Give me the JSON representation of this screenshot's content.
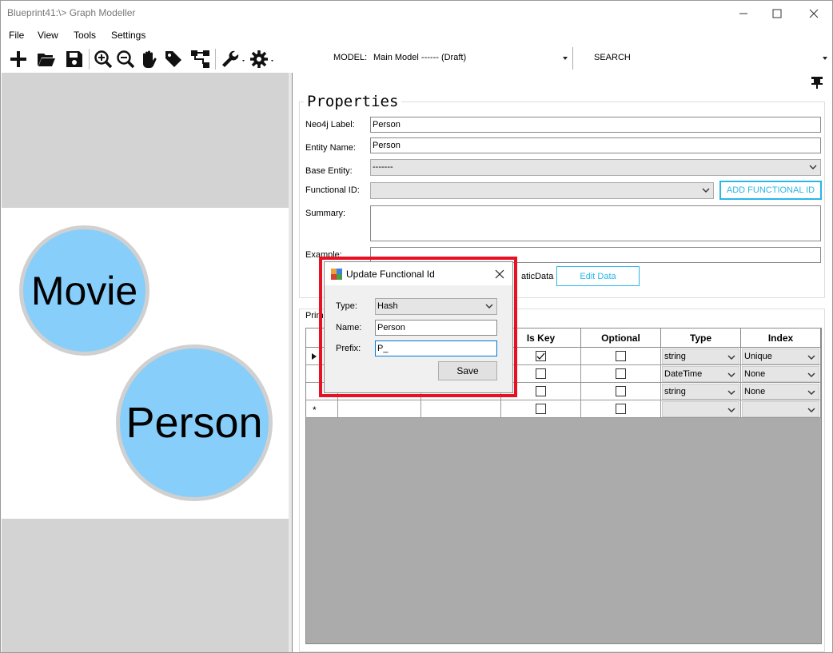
{
  "window": {
    "title": "Blueprint41:\\> Graph Modeller"
  },
  "menu": [
    "File",
    "View",
    "Tools",
    "Settings"
  ],
  "toolbar": {
    "model_label": "MODEL:",
    "model_value": "Main Model ------ (Draft)",
    "search_label": "SEARCH"
  },
  "graph": {
    "nodes": [
      {
        "label": "Movie",
        "color": "#87cefa"
      },
      {
        "label": "Person",
        "color": "#87cefa"
      }
    ]
  },
  "properties": {
    "title": "Properties",
    "neo4j_label_caption": "Neo4j Label:",
    "neo4j_label": "Person",
    "entity_name_caption": "Entity Name:",
    "entity_name": "Person",
    "base_entity_caption": "Base Entity:",
    "base_entity": "-------",
    "functional_id_caption": "Functional ID:",
    "functional_id": "",
    "add_functional_id": "ADD FUNCTIONAL ID",
    "summary_caption": "Summary:",
    "summary": "",
    "example_caption": "Example:",
    "example": "",
    "static_data_caption": "aticData",
    "edit_data": "Edit Data",
    "tab_label": "Prim"
  },
  "grid": {
    "headers": [
      "Is Key",
      "Optional",
      "Type",
      "Index"
    ],
    "rows": [
      {
        "is_key": true,
        "optional": false,
        "type": "string",
        "index": "Unique"
      },
      {
        "is_key": false,
        "optional": false,
        "type": "DateTime",
        "index": "None"
      },
      {
        "is_key": false,
        "optional": false,
        "type": "string",
        "index": "None"
      },
      {
        "is_key": false,
        "optional": false,
        "type": "",
        "index": ""
      }
    ],
    "new_row_marker": "*"
  },
  "dialog": {
    "title": "Update Functional Id",
    "type_caption": "Type:",
    "type_value": "Hash",
    "name_caption": "Name:",
    "name_value": "Person",
    "prefix_caption": "Prefix:",
    "prefix_value": "P_",
    "save_label": "Save",
    "highlight_color": "#e81123"
  },
  "colors": {
    "accent": "#29b6e8",
    "node_fill": "#87cefa"
  }
}
